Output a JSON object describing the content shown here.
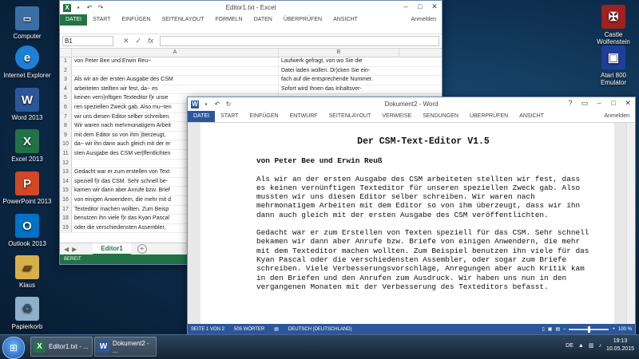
{
  "desktop": {
    "icons_left": [
      {
        "label": "Computer",
        "icon": "computer-icon"
      },
      {
        "label": "Internet Explorer",
        "icon": "ie-icon"
      },
      {
        "label": "Word 2013",
        "icon": "word-icon"
      },
      {
        "label": "Excel 2013",
        "icon": "excel-icon"
      },
      {
        "label": "PowerPoint 2013",
        "icon": "powerpoint-icon"
      },
      {
        "label": "Outlook 2013",
        "icon": "outlook-icon"
      },
      {
        "label": "Klaus",
        "icon": "user-folder-icon"
      },
      {
        "label": "Papierkorb",
        "icon": "recycle-bin-icon"
      }
    ],
    "icons_right": [
      {
        "label": "Castle Wolfenstein",
        "icon": "game-icon"
      },
      {
        "label": "Atari 800 Emulator",
        "icon": "emulator-icon"
      }
    ]
  },
  "excel": {
    "title": "Editor1.txt - Excel",
    "account": "Anmelden",
    "tabs": [
      "DATEI",
      "START",
      "EINFÜGEN",
      "SEITENLAYOUT",
      "FORMELN",
      "DATEN",
      "ÜBERPRÜFEN",
      "ANSICHT"
    ],
    "name_box": "B1",
    "fx_symbol": "fx",
    "columns": [
      "A",
      "B"
    ],
    "rows": [
      {
        "n": "1",
        "a": "von Peter Bee und Erwin Reu~",
        "b": "Laufwerk gefragt, von wo Sie die"
      },
      {
        "n": "2",
        "a": "",
        "b": "Datei laden wollen. Dr)cken Sie ein-"
      },
      {
        "n": "3",
        "a": "Als wir an der ersten Ausgabe des CSM",
        "b": "fach auf die entsprechende Nummer."
      },
      {
        "n": "4",
        "a": "arbeiteten stellten wir fest, da~ es",
        "b": "Sofort wird Ihnen das Inhaltsver-"
      },
      {
        "n": "5",
        "a": "keinen vern)nftigen Texteditor f)r unse",
        "b": ""
      },
      {
        "n": "6",
        "a": "ren speziellen Zweck gab. Also mu~ten",
        "b": ""
      },
      {
        "n": "7",
        "a": "wir uns diesen Editor selber schreiben.",
        "b": ""
      },
      {
        "n": "8",
        "a": "Wir waren nach mehrmonatigem Arbeit",
        "b": ""
      },
      {
        "n": "9",
        "a": "mit dem Editor so von ihm )berzeugt,",
        "b": ""
      },
      {
        "n": "10",
        "a": "da~ wir ihn dann auch gleich mit der er",
        "b": ""
      },
      {
        "n": "11",
        "a": "sten Ausgabe des CSM ver|ffentlichten",
        "b": ""
      },
      {
        "n": "12",
        "a": "",
        "b": ""
      },
      {
        "n": "13",
        "a": "Gedacht war er zum erstellen von Text",
        "b": ""
      },
      {
        "n": "14",
        "a": "speziell f)r das CSM. Sehr schnell be-",
        "b": ""
      },
      {
        "n": "15",
        "a": "kamen wir dann aber Anrufe bzw. Brief",
        "b": ""
      },
      {
        "n": "16",
        "a": "von einigen Anwendern, die mehr mit d",
        "b": ""
      },
      {
        "n": "17",
        "a": "Texteditor machen wollten. Zum Beisp",
        "b": ""
      },
      {
        "n": "18",
        "a": "benutzen ihn viele f)r das Kyan Pascal",
        "b": ""
      },
      {
        "n": "19",
        "a": "oder die verschiedensten Assembler,",
        "b": ""
      }
    ],
    "sheet_tab": "Editor1",
    "add_sheet": "+",
    "status": "BEREIT"
  },
  "word": {
    "title": "Dokument2 - Word",
    "account": "Anmelden",
    "tabs": [
      "DATEI",
      "START",
      "EINFÜGEN",
      "ENTWURF",
      "SEITENLAYOUT",
      "VERWEISE",
      "SENDUNGEN",
      "ÜBERPRÜFEN",
      "ANSICHT"
    ],
    "heading": "Der CSM-Text-Editor V1.5",
    "byline": "von Peter Bee und Erwin Reuß",
    "paragraph1": "Als wir an der ersten Ausgabe des CSM arbeiteten stellten wir fest, dass es keinen vernünftigen Texteditor für unseren speziellen Zweck gab. Also mussten wir uns diesen Editor selber schreiben. Wir waren nach mehrmonatigem Arbeiten mit dem Editor so von ihm überzeugt, dass wir ihn dann auch gleich mit der ersten Ausgabe des CSM veröffentlichten.",
    "paragraph2": "Gedacht war er zum Erstellen von Texten speziell für das CSM. Sehr schnell bekamen wir dann aber Anrufe bzw. Briefe von einigen Anwendern, die mehr mit dem Texteditor machen wollten. Zum Beispiel benutzen ihn viele für das Kyan Pascal oder die verschiedensten Assembler, oder sogar zum Briefe schreiben. Viele Verbesserungsvorschläge, Anregungen aber auch Kritik kam in den Briefen und den Anrufen zum Ausdruck. Wir haben uns nun in den vergangenen Monaten mit der Verbesserung des Texteditors befasst.",
    "status_page": "SEITE 1 VON 2",
    "status_words": "505 WÖRTER",
    "status_lang": "DEUTSCH (DEUTSCHLAND)",
    "zoom": "100 %"
  },
  "taskbar": {
    "buttons": [
      {
        "label": "Editor1.txt - ...",
        "icon": "excel-icon"
      },
      {
        "label": "Dokument2 - ...",
        "icon": "word-icon"
      }
    ],
    "lang": "DE",
    "time": "19:13",
    "date": "10.05.2015"
  }
}
